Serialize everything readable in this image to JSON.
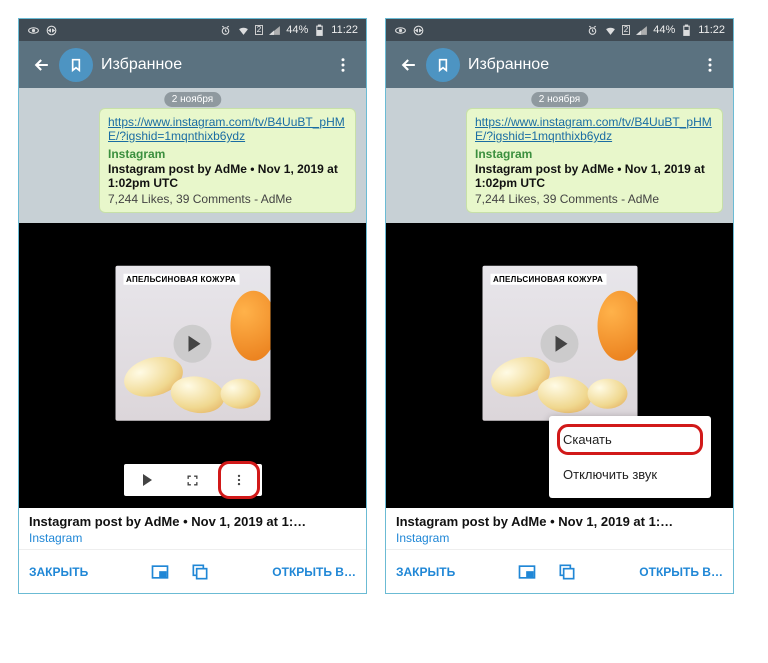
{
  "status": {
    "battery": "44%",
    "time": "11:22",
    "sim": "2"
  },
  "header": {
    "title": "Избранное"
  },
  "chat": {
    "date": "2 ноября",
    "link_url": "https://www.instagram.com/tv/B4UuBT_pHME/?igshid=1mqnthixb6ydz",
    "link_site": "Instagram",
    "link_title": "Instagram post by AdMe • Nov 1, 2019 at 1:02pm UTC",
    "link_meta": "7,244 Likes, 39 Comments - AdMe"
  },
  "video": {
    "overlay_text": "АПЕЛЬСИНОВАЯ КОЖУРА"
  },
  "context_menu": {
    "download": "Скачать",
    "mute": "Отключить звук"
  },
  "caption": {
    "title": "Instagram post by AdMe • Nov 1, 2019 at 1:…",
    "source": "Instagram"
  },
  "bottom": {
    "close": "ЗАКРЫТЬ",
    "open": "ОТКРЫТЬ В…"
  }
}
